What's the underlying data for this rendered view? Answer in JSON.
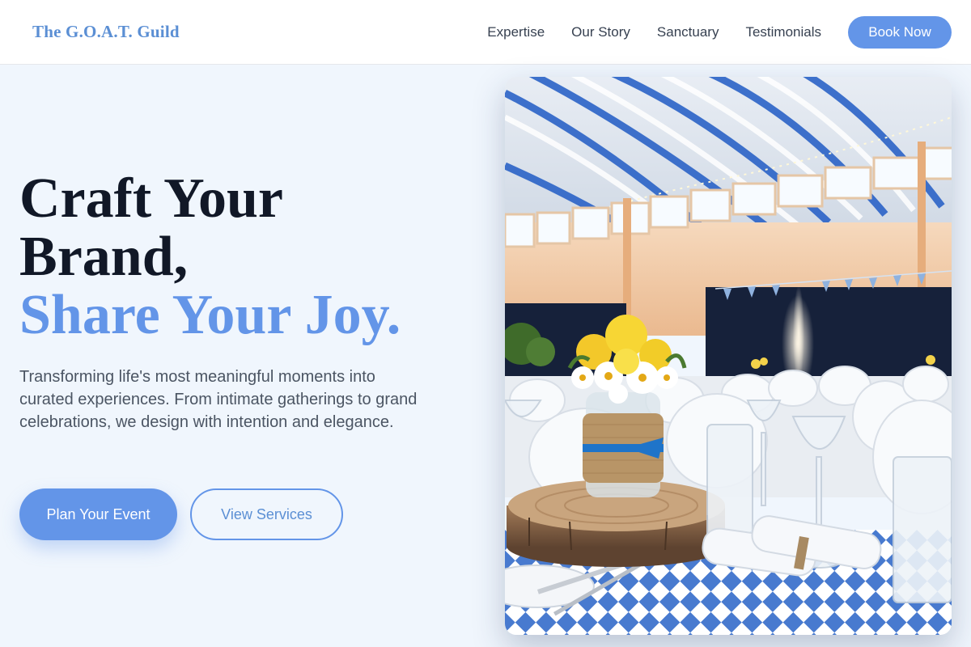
{
  "header": {
    "logo": "The G.O.A.T. Guild",
    "nav": [
      {
        "label": "Expertise"
      },
      {
        "label": "Our Story"
      },
      {
        "label": "Sanctuary"
      },
      {
        "label": "Testimonials"
      }
    ],
    "cta_label": "Book Now"
  },
  "hero": {
    "title_line1": "Craft Your",
    "title_line2": "Brand,",
    "title_accent": "Share Your Joy.",
    "description": "Transforming life's most meaningful moments into curated experiences. From intimate gatherings to grand celebrations, we design with intention and elegance.",
    "primary_cta": "Plan Your Event",
    "secondary_cta": "View Services",
    "image_alt": "Event hall with a flower centerpiece on a wooden slab, white chairs, glassware and blue-and-white tablecloth"
  },
  "colors": {
    "accent": "#6395e8",
    "background": "#f0f6fd",
    "heading": "#111827",
    "body_text": "#4b5563"
  }
}
